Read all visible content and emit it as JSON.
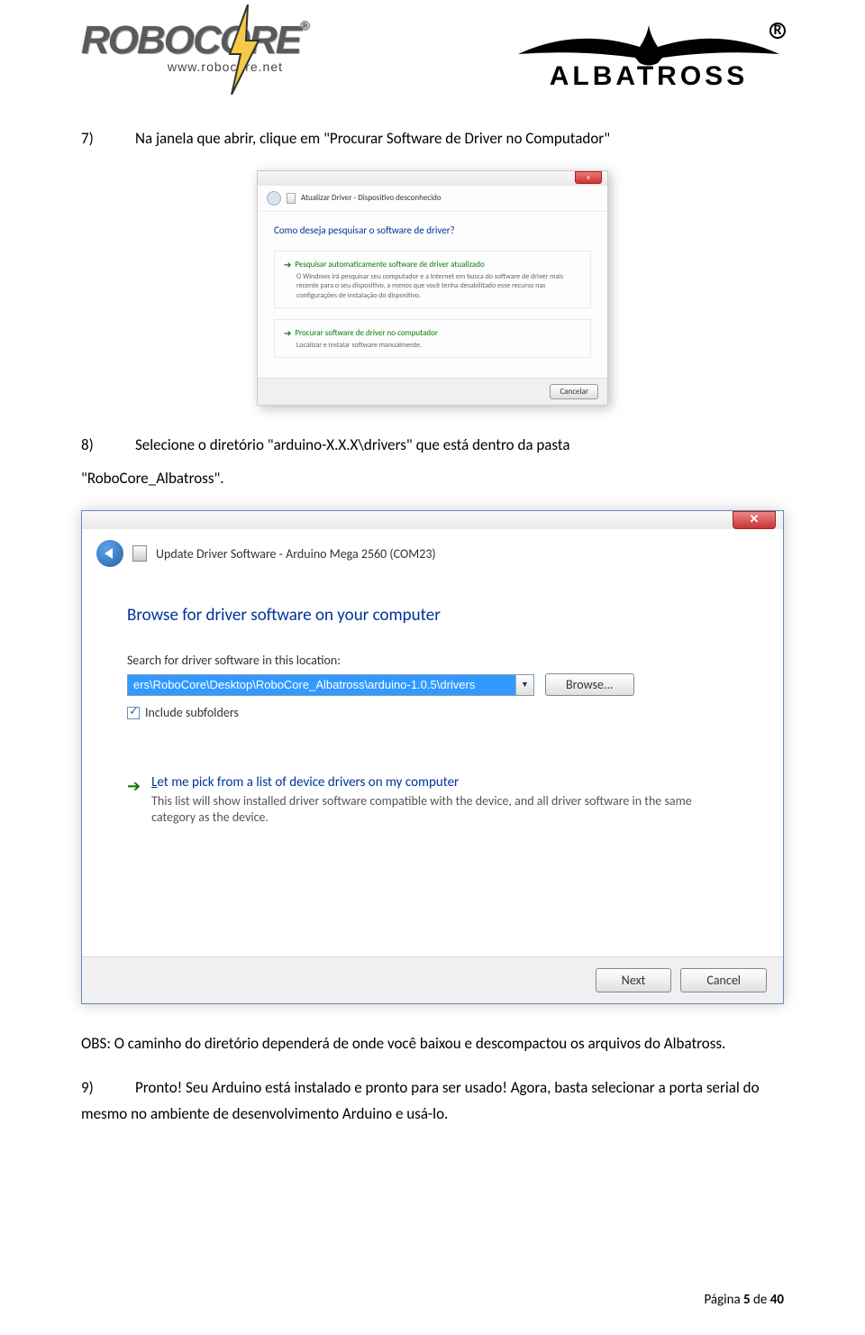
{
  "header": {
    "robocore_text": "ROBOCORE",
    "robocore_url": "www.robocore.net",
    "albatross_text": "ALBATROSS"
  },
  "step7": {
    "num": "7)",
    "text": "Na janela que abrir, clique em \"Procurar Software de Driver no Computador\""
  },
  "dialog1": {
    "title": "Atualizar Driver - Dispositivo desconhecido",
    "heading": "Como deseja pesquisar o software de driver?",
    "opt1_title": "Pesquisar automaticamente software de driver atualizado",
    "opt1_desc": "O Windows irá pesquisar seu computador e a Internet em busca do software de driver mais recente para o seu dispositivo, a menos que você tenha desabilitado esse recurso nas configurações de instalação do dispositivo.",
    "opt2_title": "Procurar software de driver no computador",
    "opt2_desc": "Localizar e instalar software manualmente.",
    "cancel": "Cancelar"
  },
  "step8": {
    "num": "8)",
    "text": "Selecione o diretório \"arduino-X.X.X\\drivers\" que está dentro da pasta",
    "text2": "\"RoboCore_Albatross\"."
  },
  "dialog2": {
    "title": "Update Driver Software - Arduino Mega 2560 (COM23)",
    "heading": "Browse for driver software on your computer",
    "search_label": "Search for driver software in this location:",
    "path": "ers\\RoboCore\\Desktop\\RoboCore_Albatross\\arduino-1.0.5\\drivers",
    "browse": "Browse...",
    "include": "Include subfolders",
    "pick_title_pre": "L",
    "pick_title_rest": "et me pick from a list of device drivers on my computer",
    "pick_desc": "This list will show installed driver software compatible with the device, and all driver software in the same category as the device.",
    "next": "Next",
    "cancel": "Cancel"
  },
  "obs": {
    "text": "OBS: O caminho do diretório dependerá de onde você baixou e descompactou os arquivos do Albatross."
  },
  "step9": {
    "num": "9)",
    "text": "Pronto! Seu Arduino está instalado e pronto para ser usado! Agora, basta selecionar a porta serial do mesmo no ambiente de desenvolvimento Arduino e usá-lo."
  },
  "footer": {
    "page_pre": "Página ",
    "page_num": "5",
    "page_post": " de ",
    "page_total": "40"
  }
}
